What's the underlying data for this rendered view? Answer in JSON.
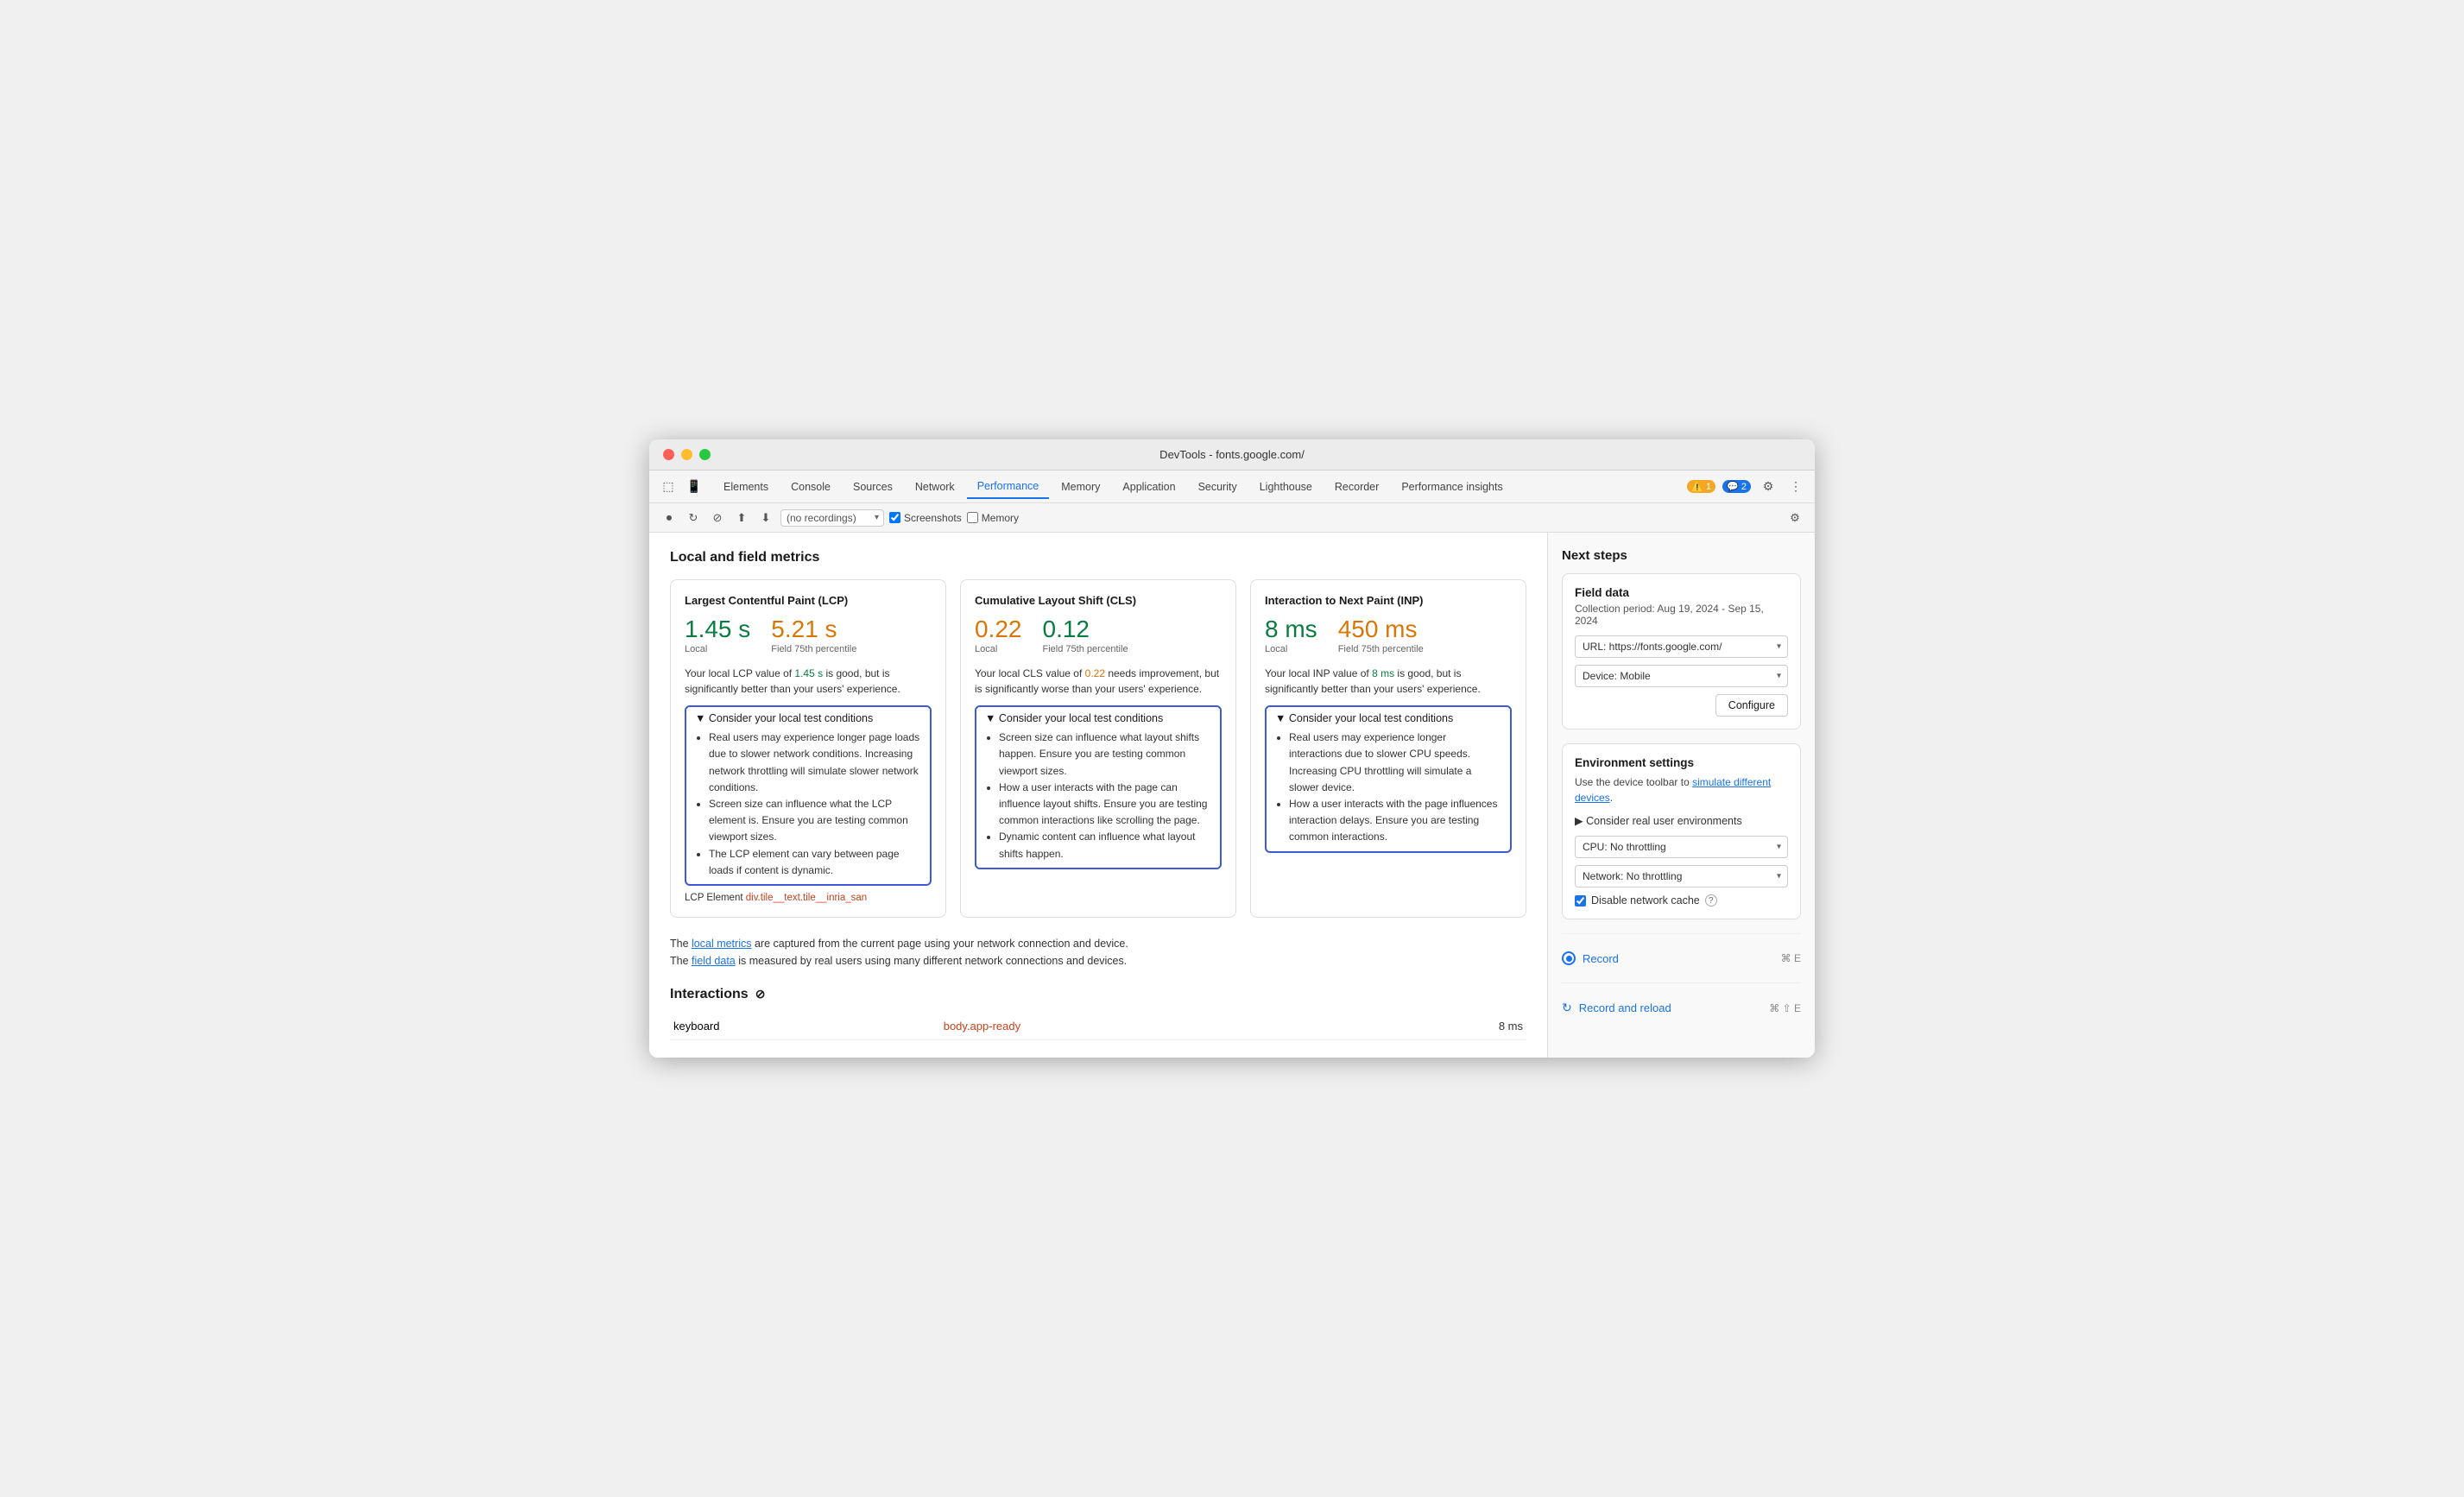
{
  "window": {
    "title": "DevTools - fonts.google.com/"
  },
  "tabs": {
    "items": [
      {
        "label": "Elements",
        "active": false
      },
      {
        "label": "Console",
        "active": false
      },
      {
        "label": "Sources",
        "active": false
      },
      {
        "label": "Network",
        "active": false
      },
      {
        "label": "Performance",
        "active": true
      },
      {
        "label": "Memory",
        "active": false
      },
      {
        "label": "Application",
        "active": false
      },
      {
        "label": "Security",
        "active": false
      },
      {
        "label": "Lighthouse",
        "active": false
      },
      {
        "label": "Recorder",
        "active": false
      },
      {
        "label": "Performance insights",
        "active": false
      }
    ],
    "badges": {
      "warning": "1",
      "info": "2"
    }
  },
  "toolbar": {
    "recordings_placeholder": "(no recordings)",
    "screenshots_label": "Screenshots",
    "memory_label": "Memory"
  },
  "section": {
    "title": "Local and field metrics"
  },
  "lcp": {
    "title": "Largest Contentful Paint (LCP)",
    "local_value": "1.45 s",
    "field_value": "5.21 s",
    "local_label": "Local",
    "field_label": "Field 75th percentile",
    "description_pre": "Your local LCP value of ",
    "description_highlight": "1.45 s",
    "description_post": " is good, but is significantly better than your users' experience.",
    "consider_title": "▼ Consider your local test conditions",
    "bullets": [
      "Real users may experience longer page loads due to slower network conditions. Increasing network throttling will simulate slower network conditions.",
      "Screen size can influence what the LCP element is. Ensure you are testing common viewport sizes.",
      "The LCP element can vary between page loads if content is dynamic."
    ],
    "lcp_element_label": "LCP Element",
    "lcp_element_value": "div.tile__text.tile__inria_san"
  },
  "cls": {
    "title": "Cumulative Layout Shift (CLS)",
    "local_value": "0.22",
    "field_value": "0.12",
    "local_label": "Local",
    "field_label": "Field 75th percentile",
    "description_pre": "Your local CLS value of ",
    "description_highlight": "0.22",
    "description_post": " needs improvement, but is significantly worse than your users' experience.",
    "consider_title": "▼ Consider your local test conditions",
    "bullets": [
      "Screen size can influence what layout shifts happen. Ensure you are testing common viewport sizes.",
      "How a user interacts with the page can influence layout shifts. Ensure you are testing common interactions like scrolling the page.",
      "Dynamic content can influence what layout shifts happen."
    ]
  },
  "inp": {
    "title": "Interaction to Next Paint (INP)",
    "local_value": "8 ms",
    "field_value": "450 ms",
    "local_label": "Local",
    "field_label": "Field 75th percentile",
    "description_pre": "Your local INP value of ",
    "description_highlight": "8 ms",
    "description_post": " is good, but is significantly better than your users' experience.",
    "consider_title": "▼ Consider your local test conditions",
    "bullets": [
      "Real users may experience longer interactions due to slower CPU speeds. Increasing CPU throttling will simulate a slower device.",
      "How a user interacts with the page influences interaction delays. Ensure you are testing common interactions."
    ]
  },
  "footer": {
    "line1_pre": "The ",
    "line1_link": "local metrics",
    "line1_post": " are captured from the current page using your network connection and device.",
    "line2_pre": "The ",
    "line2_link": "field data",
    "line2_post": " is measured by real users using many different network connections and devices."
  },
  "interactions": {
    "title": "Interactions",
    "rows": [
      {
        "name": "keyboard",
        "selector": "body.app-ready",
        "value": "8 ms"
      }
    ]
  },
  "sidebar": {
    "title": "Next steps",
    "field_data": {
      "title": "Field data",
      "subtitle": "Collection period: Aug 19, 2024 - Sep 15, 2024",
      "url_value": "URL: https://fonts.google.com/",
      "device_value": "Device: Mobile",
      "configure_label": "Configure"
    },
    "env": {
      "title": "Environment settings",
      "description_pre": "Use the device toolbar to ",
      "description_link": "simulate different devices",
      "description_post": ".",
      "consider_label": "▶ Consider real user environments",
      "cpu_label": "CPU: No throttling",
      "network_label": "Network: No throttling",
      "disable_cache_label": "Disable network cache"
    },
    "record": {
      "label": "Record",
      "shortcut": "⌘ E"
    },
    "record_reload": {
      "label": "Record and reload",
      "shortcut": "⌘ ⇧ E"
    }
  }
}
